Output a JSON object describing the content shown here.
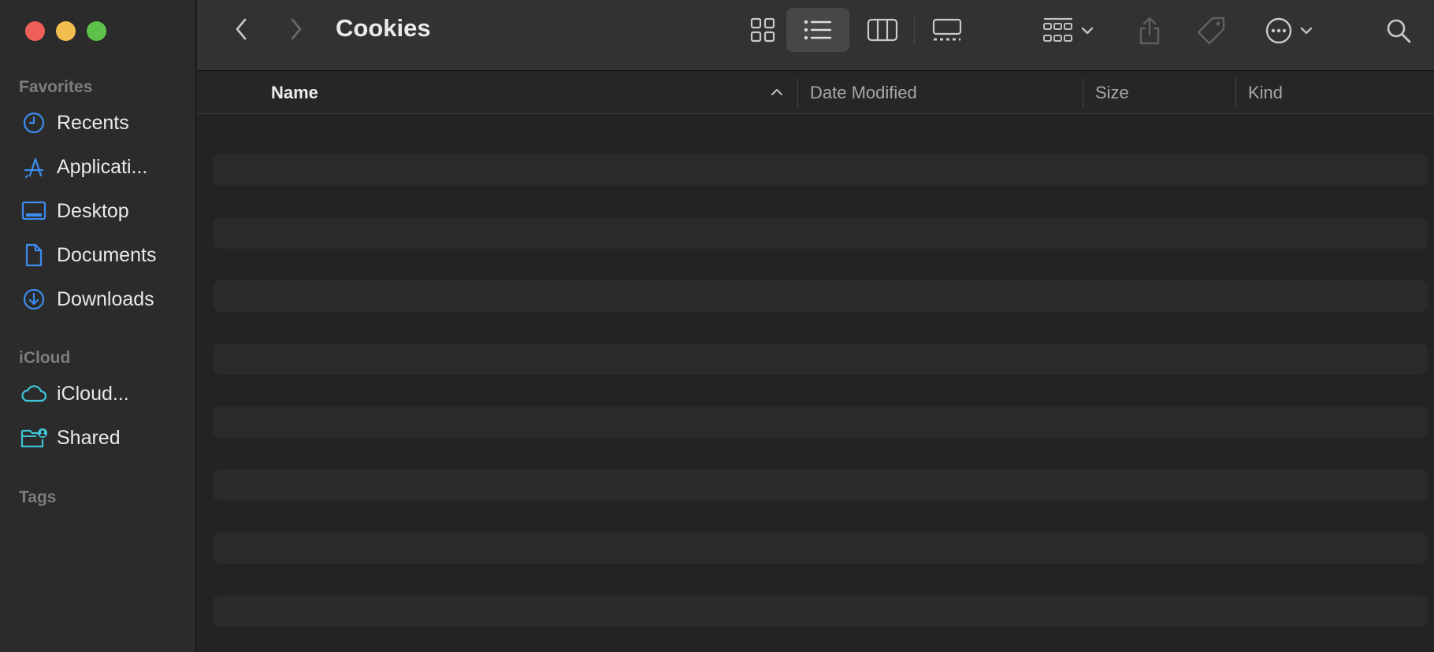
{
  "window": {
    "title": "Cookies"
  },
  "sidebar": {
    "sections": {
      "favorites": "Favorites",
      "icloud": "iCloud",
      "tags": "Tags"
    },
    "favorites": [
      {
        "label": "Recents",
        "icon": "clock-icon"
      },
      {
        "label": "Applicati...",
        "icon": "applications-icon"
      },
      {
        "label": "Desktop",
        "icon": "desktop-icon"
      },
      {
        "label": "Documents",
        "icon": "document-icon"
      },
      {
        "label": "Downloads",
        "icon": "download-icon"
      }
    ],
    "icloud": [
      {
        "label": "iCloud...",
        "icon": "cloud-icon"
      },
      {
        "label": "Shared",
        "icon": "shared-folder-icon"
      }
    ]
  },
  "toolbar": {
    "view_modes": [
      "icon-view",
      "list-view",
      "column-view",
      "gallery-view"
    ],
    "active_view": "list-view"
  },
  "columns": {
    "name": "Name",
    "date_modified": "Date Modified",
    "size": "Size",
    "kind": "Kind"
  },
  "colors": {
    "accent": "#3b8df0",
    "icloud_accent": "#3ec6d8"
  }
}
